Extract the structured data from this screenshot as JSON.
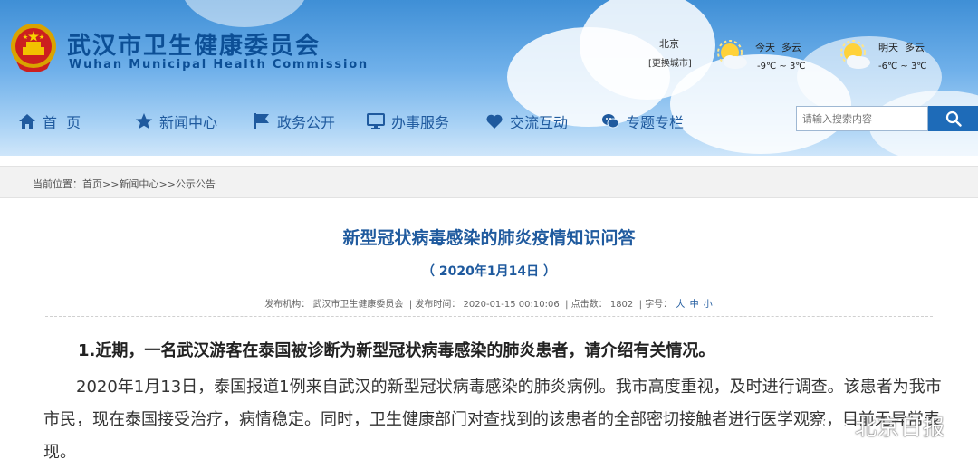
{
  "header": {
    "logo_cn": "武汉市卫生健康委员会",
    "logo_en": "Wuhan Municipal Health Commission"
  },
  "weather": {
    "city": "北京",
    "change_city": "[更换城市]",
    "today_label": "今天",
    "today_condition": "多云",
    "today_temp": "-9℃ ~ 3℃",
    "tomorrow_label": "明天",
    "tomorrow_condition": "多云",
    "tomorrow_temp": "-6℃ ~ 3℃",
    "icon": "partly-cloudy-icon"
  },
  "nav": [
    {
      "label": "首  页",
      "icon": "home-icon"
    },
    {
      "label": "新闻中心",
      "icon": "star-icon"
    },
    {
      "label": "政务公开",
      "icon": "flag-icon"
    },
    {
      "label": "办事服务",
      "icon": "monitor-icon"
    },
    {
      "label": "交流互动",
      "icon": "heart-icon"
    },
    {
      "label": "专题专栏",
      "icon": "chat-icon"
    }
  ],
  "search": {
    "placeholder": "请输入搜索内容",
    "button_icon": "search-icon"
  },
  "breadcrumb": {
    "prefix": "当前位置：",
    "items": [
      "首页",
      "新闻中心",
      "公示公告"
    ],
    "separator": ">>"
  },
  "article": {
    "title": "新型冠状病毒感染的肺炎疫情知识问答",
    "date": "（ 2020年1月14日 ）",
    "meta": {
      "source_label": "发布机构：",
      "source": "武汉市卫生健康委员会",
      "time_label": "发布时间：",
      "time": "2020-01-15 00:10:06",
      "views_label": "点击数：",
      "views": "1802",
      "fontsize_label": "字号：",
      "font_sizes": [
        "大",
        "中",
        "小"
      ]
    },
    "question": "1.近期，一名武汉游客在泰国被诊断为新型冠状病毒感染的肺炎患者，请介绍有关情况。",
    "answer": "2020年1月13日，泰国报道1例来自武汉的新型冠状病毒感染的肺炎病例。我市高度重视，及时进行调查。该患者为我市市民，现在泰国接受治疗，病情稳定。同时，卫生健康部门对查找到的该患者的全部密切接触者进行医学观察，目前无异常表现。"
  },
  "watermark": {
    "text": "北京日报",
    "icon": "wechat-icon"
  },
  "colors": {
    "brand_blue": "#1f5a9e",
    "header_sky": "#3f8fd6",
    "search_button": "#1e6bb8"
  }
}
